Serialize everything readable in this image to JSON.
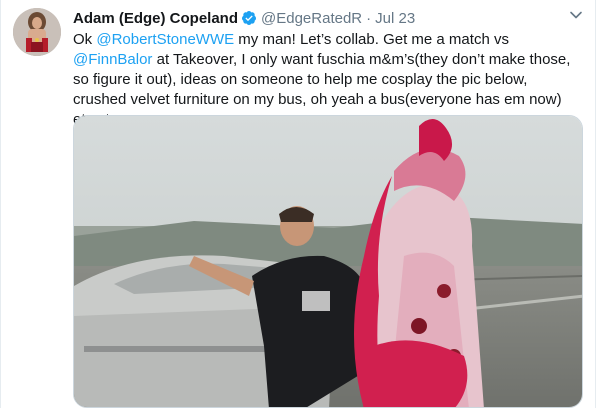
{
  "author": {
    "name": "Adam (Edge) Copeland",
    "handle": "@EdgeRatedR",
    "separator": "·",
    "date": "Jul 23"
  },
  "tweet": {
    "seg1": "Ok ",
    "mention1": "@RobertStoneWWE",
    "seg2": " my man! Let’s collab. Get me a match vs ",
    "mention2": "@FinnBalor",
    "seg3": " at Takeover, I only want fuschia m&m’s(they don’t make those, so figure it out), ideas on someone to help me cosplay the pic below, crushed velvet furniture on my bus, oh yeah a bus(everyone has em now) etc etc"
  },
  "icons": {
    "verified": "verified-badge-icon",
    "caret": "chevron-down-icon"
  },
  "colors": {
    "link": "#1da1f2",
    "verified": "#1da1f2",
    "muted": "#657786"
  }
}
